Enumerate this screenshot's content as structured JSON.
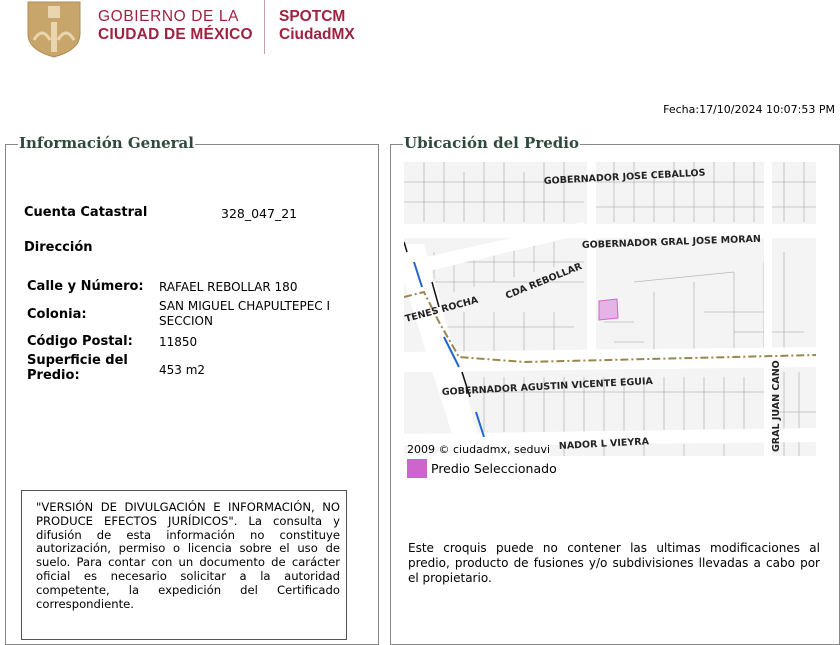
{
  "header": {
    "gov_line1": "GOBIERNO DE LA",
    "gov_line2": "CIUDAD DE MÉXICO",
    "app_line1": "SPOTCM",
    "app_line2": "CiudadMX",
    "date": "Fecha:17/10/2024 10:07:53 PM"
  },
  "general": {
    "title": "Información General",
    "cuenta_label": "Cuenta Catastral",
    "cuenta_value": "328_047_21",
    "direccion_label": "Dirección",
    "calle_label": "Calle y Número:",
    "calle_value": "RAFAEL REBOLLAR 180",
    "colonia_label": "Colonia:",
    "colonia_value": "SAN MIGUEL CHAPULTEPEC I SECCION",
    "cp_label": "Código Postal:",
    "cp_value": "11850",
    "superficie_label": "Superficie del Predio:",
    "superficie_value": "453 m2",
    "disclaimer": "\"VERSIÓN DE DIVULGACIÓN E INFORMACIÓN, NO PRODUCE EFECTOS JURÍDICOS\". La consulta y difusión de esta información no constituye autorización, permiso o licencia sobre el uso de suelo. Para contar con un documento de carácter oficial es necesario solicitar a la autoridad competente, la expedición del Certificado correspondiente."
  },
  "location": {
    "title": "Ubicación del Predio",
    "streets": [
      "GOBERNADOR JOSE CEBALLOS",
      "GOBERNADOR GRAL JOSE MORAN",
      "CDA REBOLLAR",
      "TENES ROCHA",
      "GOBERNADOR AGUSTIN VICENTE EGUIA",
      "NADOR L VIEYRA",
      "GRAL JUAN CANO"
    ],
    "copyright": "2009 © ciudadmx, seduvi",
    "legend_label": "Predio Seleccionado",
    "colors": {
      "selected": "#cc66cc",
      "parcel_fill": "#f4f4f4",
      "parcel_line": "#b8b8b8"
    },
    "note": "Este croquis puede no contener las ultimas modificaciones al predio, producto de fusiones y/o subdivisiones llevadas a cabo por el propietario."
  }
}
